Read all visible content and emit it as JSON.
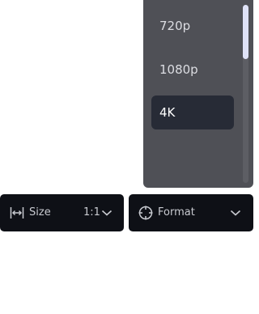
{
  "resolution_menu": {
    "options": [
      {
        "label": "720p"
      },
      {
        "label": "1080p"
      },
      {
        "label": "4K",
        "selected": true
      }
    ]
  },
  "size_control": {
    "label": "Size",
    "value": "1:1",
    "icon": "resize-horizontal-icon"
  },
  "format_control": {
    "label": "Format",
    "icon": "crosshair-icon"
  },
  "colors": {
    "dropdown_bg": "#4f5056",
    "selected_bg": "#272b36",
    "control_bg": "#0e1016",
    "scroll_thumb": "#dfe2f7"
  }
}
